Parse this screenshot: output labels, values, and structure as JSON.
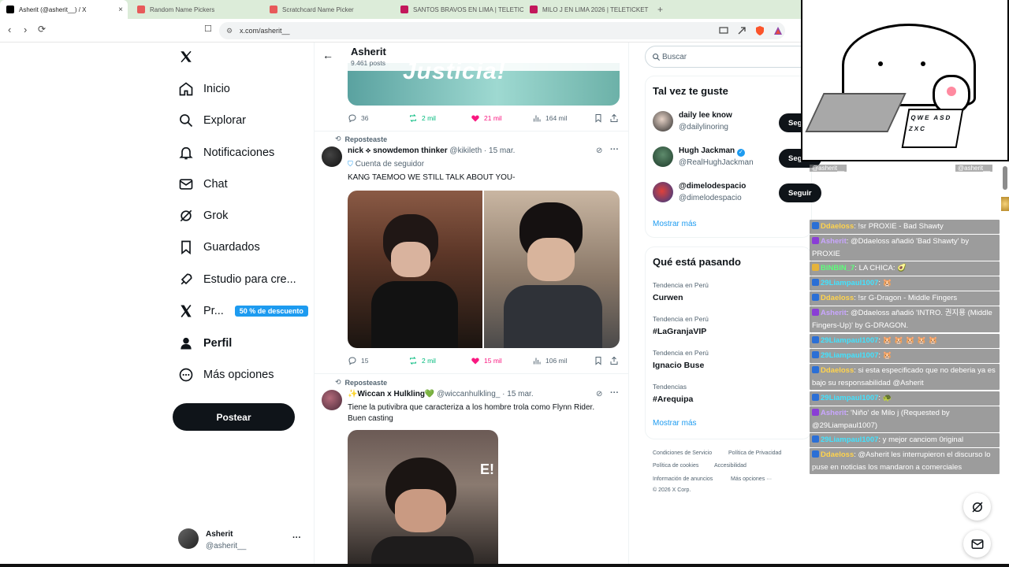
{
  "browser": {
    "tabs": [
      {
        "label": "Asherit (@asherit__) / X",
        "active": true,
        "close": "×",
        "favicon": "x-logo"
      },
      {
        "label": "Random Name Pickers",
        "favicon": "picker-icon"
      },
      {
        "label": "Scratchcard Name Picker",
        "favicon": "picker-icon"
      },
      {
        "label": "SANTOS BRAVOS EN LIMA | TELETIC...",
        "favicon": "teleticket-icon"
      },
      {
        "label": "MILO J EN LIMA 2026 | TELETICKET",
        "favicon": "teleticket-icon"
      }
    ],
    "new_tab": "+",
    "url": "x.com/asherit__"
  },
  "nav": {
    "items": [
      {
        "label": "Inicio",
        "icon": "home-icon"
      },
      {
        "label": "Explorar",
        "icon": "search-icon"
      },
      {
        "label": "Notificaciones",
        "icon": "bell-icon"
      },
      {
        "label": "Chat",
        "icon": "mail-icon"
      },
      {
        "label": "Grok",
        "icon": "grok-icon"
      },
      {
        "label": "Guardados",
        "icon": "bookmark-icon"
      },
      {
        "label": "Estudio para cre...",
        "icon": "rocket-icon"
      },
      {
        "label": "Pr...",
        "icon": "x-logo-icon",
        "badge": "50 % de descuento"
      },
      {
        "label": "Perfil",
        "icon": "person-icon"
      },
      {
        "label": "Más opciones",
        "icon": "more-circle-icon"
      }
    ],
    "post_button": "Postear",
    "account": {
      "name": "Asherit",
      "handle": "@asherit__",
      "more": "···"
    }
  },
  "profile_header": {
    "name": "Asherit",
    "posts": "9.461 posts"
  },
  "tweet1": {
    "media_caption": "Justicia!",
    "replies": "36",
    "reposts": "2 mil",
    "likes": "21 mil",
    "views": "164 mil"
  },
  "tweet2": {
    "repost_label": "Reposteaste",
    "author": "nick ⟡ snowdemon thinker",
    "handle": "@kikileth",
    "date": "· 15 mar.",
    "follower_note": "Cuenta de seguidor",
    "text": "KANG TAEMOO WE STILL TALK ABOUT YOU-",
    "replies": "15",
    "reposts": "2 mil",
    "likes": "15 mil",
    "views": "106 mil"
  },
  "tweet3": {
    "repost_label": "Reposteaste",
    "author": "✨Wiccan x Hulkling💚",
    "handle": "@wiccanhulkling_",
    "date": "· 15 mar.",
    "text": "Tiene la putivibra que caracteriza a los hombre trola como Flynn Rider. Buen casting",
    "watermark": "E!"
  },
  "sidebar": {
    "search_placeholder": "Buscar",
    "suggest_title": "Tal vez te guste",
    "suggestions": [
      {
        "name": "daily lee know",
        "handle": "@dailylinoring",
        "button": "Seguir"
      },
      {
        "name": "Hugh Jackman",
        "handle": "@RealHughJackman",
        "button": "Seguir",
        "verified": true
      },
      {
        "name": "@dimelodespacio",
        "handle": "@dimelodespacio",
        "button": "Seguir"
      }
    ],
    "show_more": "Mostrar más",
    "trends_title": "Qué está pasando",
    "trends": [
      {
        "context": "Tendencia en Perú",
        "name": "Curwen"
      },
      {
        "context": "Tendencia en Perú",
        "name": "#LaGranjaVIP"
      },
      {
        "context": "Tendencia en Perú",
        "name": "Ignacio Buse"
      },
      {
        "context": "Tendencias",
        "name": "#Arequipa"
      }
    ],
    "trends_more": "Mostrar más",
    "footer": [
      "Condiciones de Servicio",
      "Política de Privacidad",
      "Política de cookies",
      "Accesibilidad",
      "Información de anuncios",
      "Más opciones ···",
      "© 2026 X Corp."
    ]
  },
  "overlay": {
    "keyboard_keys": "QWE ASD ZXC",
    "tag_left": "@asherit__",
    "tag_right": "@asherit__",
    "chat": [
      {
        "user": "Ddaeloss",
        "color": "gold",
        "text": ": !sr PROXIE - Bad Shawty"
      },
      {
        "user": "Asherit",
        "color": "pur",
        "text": ": @Ddaeloss añadió 'Bad Shawty' by PROXIE"
      },
      {
        "user": "BINBIN_7",
        "color": "green",
        "text": ": LA CHICA: 🥑"
      },
      {
        "user": "29Liampaul1007",
        "color": "cyan",
        "text": ": 🐹"
      },
      {
        "user": "Ddaeloss",
        "color": "gold",
        "text": ": !sr G-Dragon - Middle Fingers"
      },
      {
        "user": "Asherit",
        "color": "pur",
        "text": ": @Ddaeloss añadió 'INTRO. 권지용 (Middle Fingers-Up)' by G-DRAGON."
      },
      {
        "user": "29Liampaul1007",
        "color": "cyan",
        "text": ": 🐹 🐹 🐹 🐹 🐹"
      },
      {
        "user": "29Liampaul1007",
        "color": "cyan",
        "text": ": 🐹"
      },
      {
        "user": "Ddaeloss",
        "color": "gold",
        "text": ": si esta especificado que no deberia ya es bajo su responsabilidad @Asherit"
      },
      {
        "user": "29Liampaul1007",
        "color": "cyan",
        "text": ": 🐢"
      },
      {
        "user": "Asherit",
        "color": "pur",
        "text": ": 'Niño' de Milo j (Requested by @29Liampaul1007)"
      },
      {
        "user": "29Liampaul1007",
        "color": "cyan",
        "text": ": y mejor canciom 0riginal"
      },
      {
        "user": "Ddaeloss",
        "color": "gold",
        "text": ": @Asherit les interrupieron el discurso lo puse en noticias los mandaron a comerciales"
      }
    ]
  },
  "colors": {
    "accent": "#1d9bf0",
    "like": "#f91880",
    "repost": "#00ba7c",
    "ink": "#0f1419",
    "muted": "#536471"
  }
}
